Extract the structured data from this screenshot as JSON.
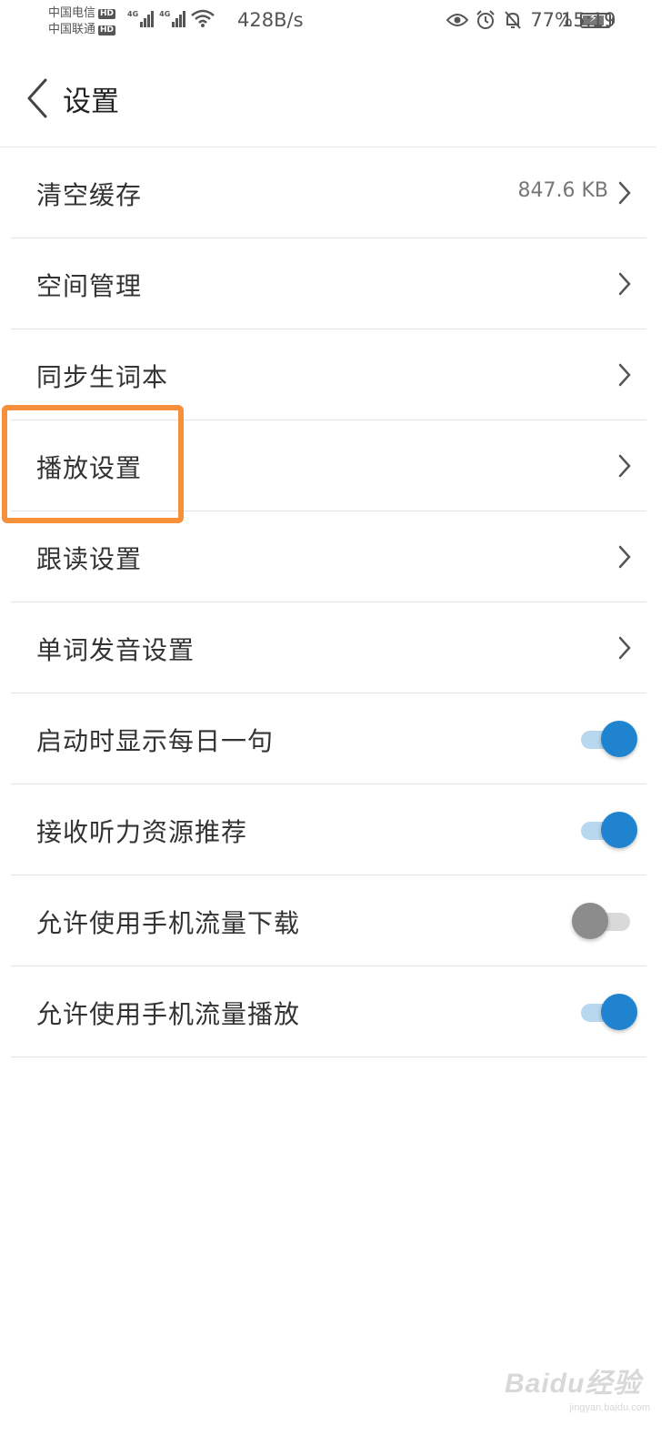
{
  "status_bar": {
    "carrier_1": "中国电信",
    "carrier_2": "中国联通",
    "hd_badge": "HD",
    "network_type": "4G",
    "net_speed": "428B/s",
    "battery": "77%",
    "time": "15:19",
    "icons": [
      "signal-icon",
      "wifi-icon",
      "eye-icon",
      "alarm-icon",
      "bell-off-icon",
      "battery-icon"
    ]
  },
  "header": {
    "title": "设置",
    "back_icon": "chevron-left-icon"
  },
  "settings": [
    {
      "label": "清空缓存",
      "value": "847.6 KB",
      "type": "nav"
    },
    {
      "label": "空间管理",
      "type": "nav"
    },
    {
      "label": "同步生词本",
      "type": "nav"
    },
    {
      "label": "播放设置",
      "type": "nav",
      "highlighted": true
    },
    {
      "label": "跟读设置",
      "type": "nav"
    },
    {
      "label": "单词发音设置",
      "type": "nav"
    },
    {
      "label": "启动时显示每日一句",
      "type": "toggle",
      "on": true
    },
    {
      "label": "接收听力资源推荐",
      "type": "toggle",
      "on": true
    },
    {
      "label": "允许使用手机流量下载",
      "type": "toggle",
      "on": false
    },
    {
      "label": "允许使用手机流量播放",
      "type": "toggle",
      "on": true
    }
  ],
  "colors": {
    "toggle_on": "#1f83d0",
    "toggle_off": "#8c8c8c",
    "highlight": "#f7903a"
  },
  "watermark": {
    "logo": "Baidu经验",
    "url": "jingyan.baidu.com"
  }
}
